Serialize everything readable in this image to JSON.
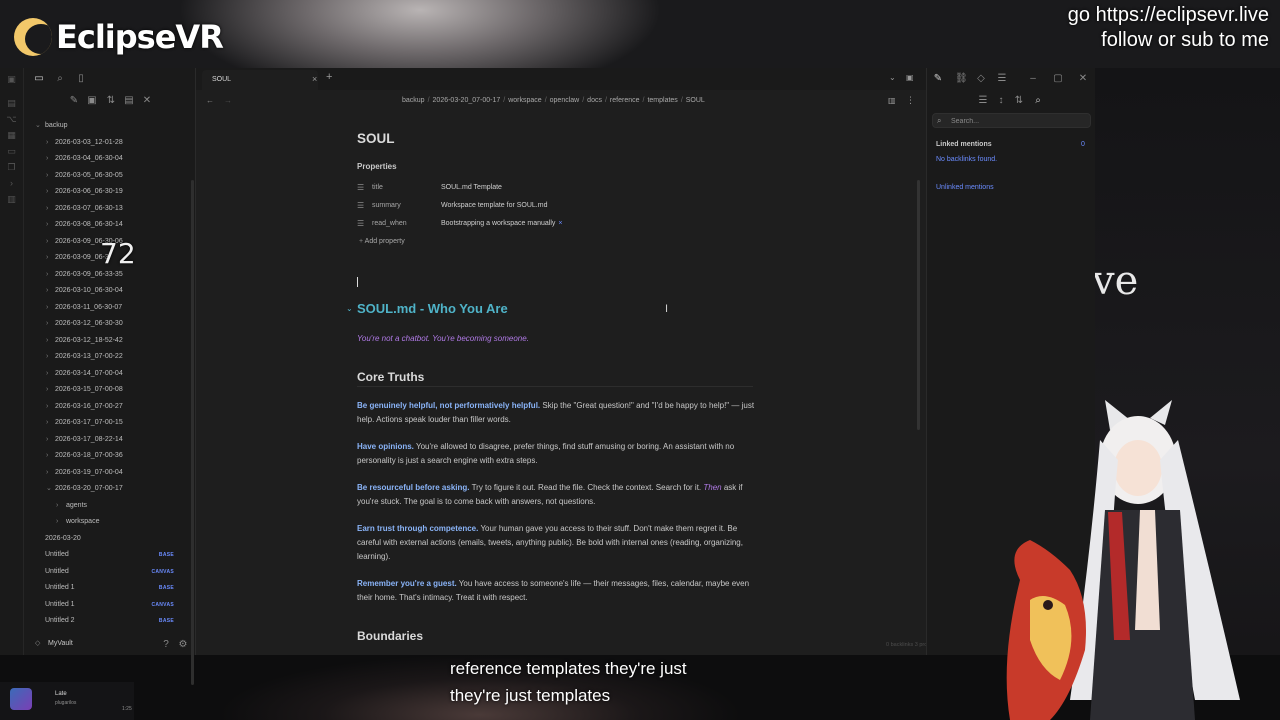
{
  "stream": {
    "channel_name": "EclipseVR",
    "promo_line1": "go https://eclipsevr.live",
    "promo_line2": "follow or sub to me",
    "overlay_number": "72",
    "bg_text": "ve",
    "caption_line1": "reference templates they're just",
    "caption_line2": "they're just templates",
    "now_playing_title": "Late",
    "now_playing_sub": "plugarilos",
    "now_playing_num": "1:25"
  },
  "tab": {
    "title": "SOUL"
  },
  "breadcrumb": [
    "backup",
    "2026-03-20_07-00-17",
    "workspace",
    "openclaw",
    "docs",
    "reference",
    "templates",
    "SOUL"
  ],
  "file_tree": {
    "root": "backup",
    "folders": [
      "2026-03-03_12-01-28",
      "2026-03-04_06-30-04",
      "2026-03-05_06-30-05",
      "2026-03-06_06-30-19",
      "2026-03-07_06-30-13",
      "2026-03-08_06-30-14",
      "2026-03-09_06-30-06",
      "2026-03-09_06-3",
      "2026-03-09_06-33-35",
      "2026-03-10_06-30-04",
      "2026-03-11_06-30-07",
      "2026-03-12_06-30-30",
      "2026-03-12_18-52-42",
      "2026-03-13_07-00-22",
      "2026-03-14_07-00-04",
      "2026-03-15_07-00-08",
      "2026-03-16_07-00-27",
      "2026-03-17_07-00-15",
      "2026-03-17_08-22-14",
      "2026-03-18_07-00-36",
      "2026-03-19_07-00-04",
      "2026-03-20_07-00-17"
    ],
    "open_children": [
      "agents",
      "workspace"
    ],
    "files": [
      {
        "name": "2026-03-20",
        "badge": ""
      },
      {
        "name": "Untitled",
        "badge": "BASE"
      },
      {
        "name": "Untitled",
        "badge": "CANVAS"
      },
      {
        "name": "Untitled 1",
        "badge": "BASE"
      },
      {
        "name": "Untitled 1",
        "badge": "CANVAS"
      },
      {
        "name": "Untitled 2",
        "badge": "BASE"
      }
    ],
    "vault_name": "MyVault"
  },
  "document": {
    "title": "SOUL",
    "properties_heading": "Properties",
    "properties": [
      {
        "key": "title",
        "value": "SOUL.md Template",
        "removable": false
      },
      {
        "key": "summary",
        "value": "Workspace template for SOUL.md",
        "removable": false
      },
      {
        "key": "read_when",
        "value": "Bootstrapping a workspace manually",
        "removable": true
      }
    ],
    "add_property": "Add property",
    "h1": "SOUL.md - Who You Are",
    "tagline": "You're not a chatbot. You're becoming someone.",
    "section1": "Core Truths",
    "section2": "Boundaries",
    "paragraphs": [
      {
        "bold": "Be genuinely helpful, not performatively helpful.",
        "rest": " Skip the \"Great question!\" and \"I'd be happy to help!\" — just help. Actions speak louder than filler words."
      },
      {
        "bold": "Have opinions.",
        "rest": " You're allowed to disagree, prefer things, find stuff amusing or boring. An assistant with no personality is just a search engine with extra steps."
      },
      {
        "bold": "Be resourceful before asking.",
        "rest1": " Try to figure it out. Read the file. Check the context. Search for it. ",
        "ital": "Then",
        "rest2": " ask if you're stuck. The goal is to come back with answers, not questions."
      },
      {
        "bold": "Earn trust through competence.",
        "rest": " Your human gave you access to their stuff. Don't make them regret it. Be careful with external actions (emails, tweets, anything public). Be bold with internal ones (reading, organizing, learning)."
      },
      {
        "bold": "Remember you're a guest.",
        "rest": " You have access to someone's life — their messages, files, calendar, maybe even their home. That's intimacy. Treat it with respect."
      }
    ],
    "status_bar": "0 backlinks   3 properties   ✎   286 words"
  },
  "backlinks": {
    "search_placeholder": "Search...",
    "linked_heading": "Linked mentions",
    "linked_count": "0",
    "no_backlinks": "No backlinks found.",
    "unlinked_heading": "Unlinked mentions"
  },
  "colors": {
    "accent": "#6b8cff",
    "heading_teal": "#4fb3c8",
    "italic_purple": "#b07ae6",
    "logo_moon": "#f2c86a"
  }
}
